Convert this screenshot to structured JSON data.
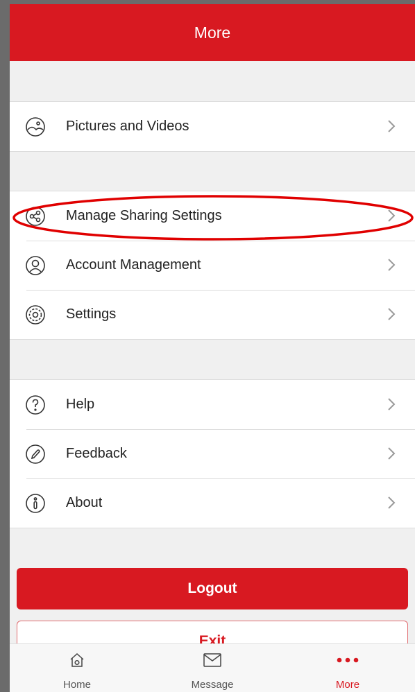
{
  "header": {
    "title": "More"
  },
  "groups": [
    {
      "items": [
        {
          "label": "Pictures and Videos",
          "icon": "image-icon"
        }
      ]
    },
    {
      "items": [
        {
          "label": "Manage Sharing Settings",
          "icon": "share-icon"
        },
        {
          "label": "Account Management",
          "icon": "person-icon"
        },
        {
          "label": "Settings",
          "icon": "gear-icon"
        }
      ]
    },
    {
      "items": [
        {
          "label": "Help",
          "icon": "help-icon"
        },
        {
          "label": "Feedback",
          "icon": "pencil-icon"
        },
        {
          "label": "About",
          "icon": "info-icon"
        }
      ]
    }
  ],
  "buttons": {
    "logout": "Logout",
    "exit": "Exit"
  },
  "tabs": [
    {
      "label": "Home",
      "icon": "home-icon"
    },
    {
      "label": "Message",
      "icon": "mail-icon"
    },
    {
      "label": "More",
      "icon": "more-dots-icon",
      "active": true
    }
  ],
  "colors": {
    "brand_red": "#d81921",
    "highlight_annotation": "#e00000"
  }
}
